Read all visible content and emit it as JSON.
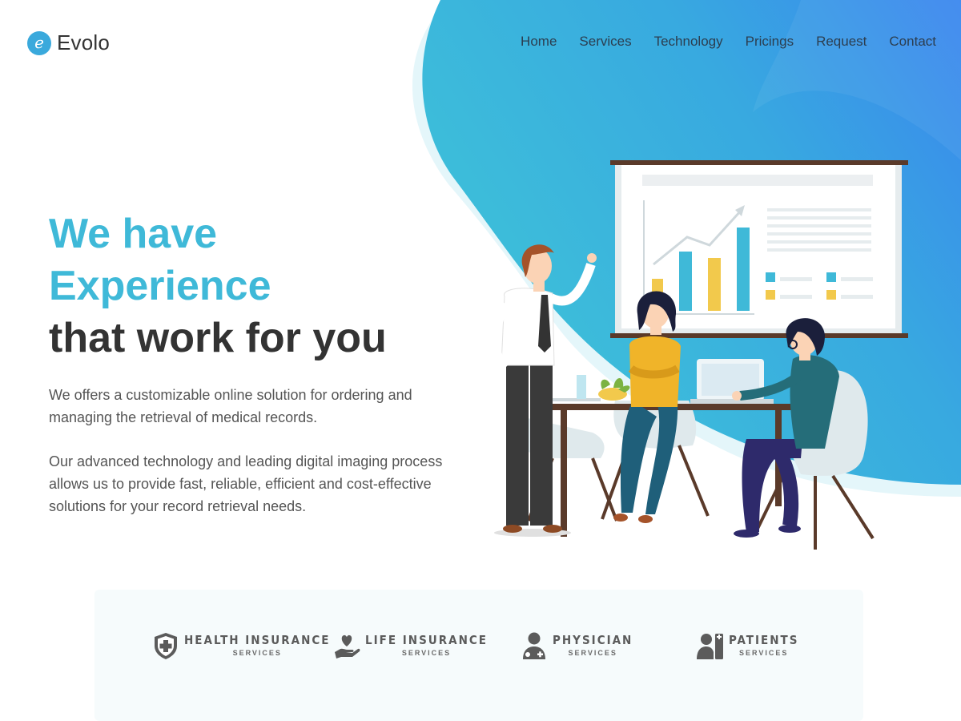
{
  "brand": {
    "logo_letter": "e",
    "name": "Evolo"
  },
  "nav": {
    "items": [
      {
        "label": "Home"
      },
      {
        "label": "Services"
      },
      {
        "label": "Technology"
      },
      {
        "label": "Pricings"
      },
      {
        "label": "Request"
      },
      {
        "label": "Contact"
      }
    ]
  },
  "hero": {
    "line1": "We have",
    "line2": "Experience",
    "line3": "that work for you",
    "paragraph1": "We offers a customizable online solution for ordering and managing the retrieval of medical records.",
    "paragraph2": "Our advanced technology and leading digital imaging process allows us to provide fast, reliable, efficient and cost-effective solutions for your record retrieval needs."
  },
  "services": [
    {
      "title": "HEALTH INSURANCE",
      "subtitle": "SERVICES",
      "icon": "shield-cross-icon"
    },
    {
      "title": "LIFE INSURANCE",
      "subtitle": "SERVICES",
      "icon": "heart-hand-icon"
    },
    {
      "title": "PHYSICIAN",
      "subtitle": "SERVICES",
      "icon": "doctor-icon"
    },
    {
      "title": "PATIENTS",
      "subtitle": "SERVICES",
      "icon": "patient-icon"
    }
  ],
  "colors": {
    "accent": "#3fb9d8",
    "blob_start": "#3ec3d8",
    "blob_end": "#3a86ee",
    "text_dark": "#333333",
    "icon_gray": "#5b5b5b"
  }
}
